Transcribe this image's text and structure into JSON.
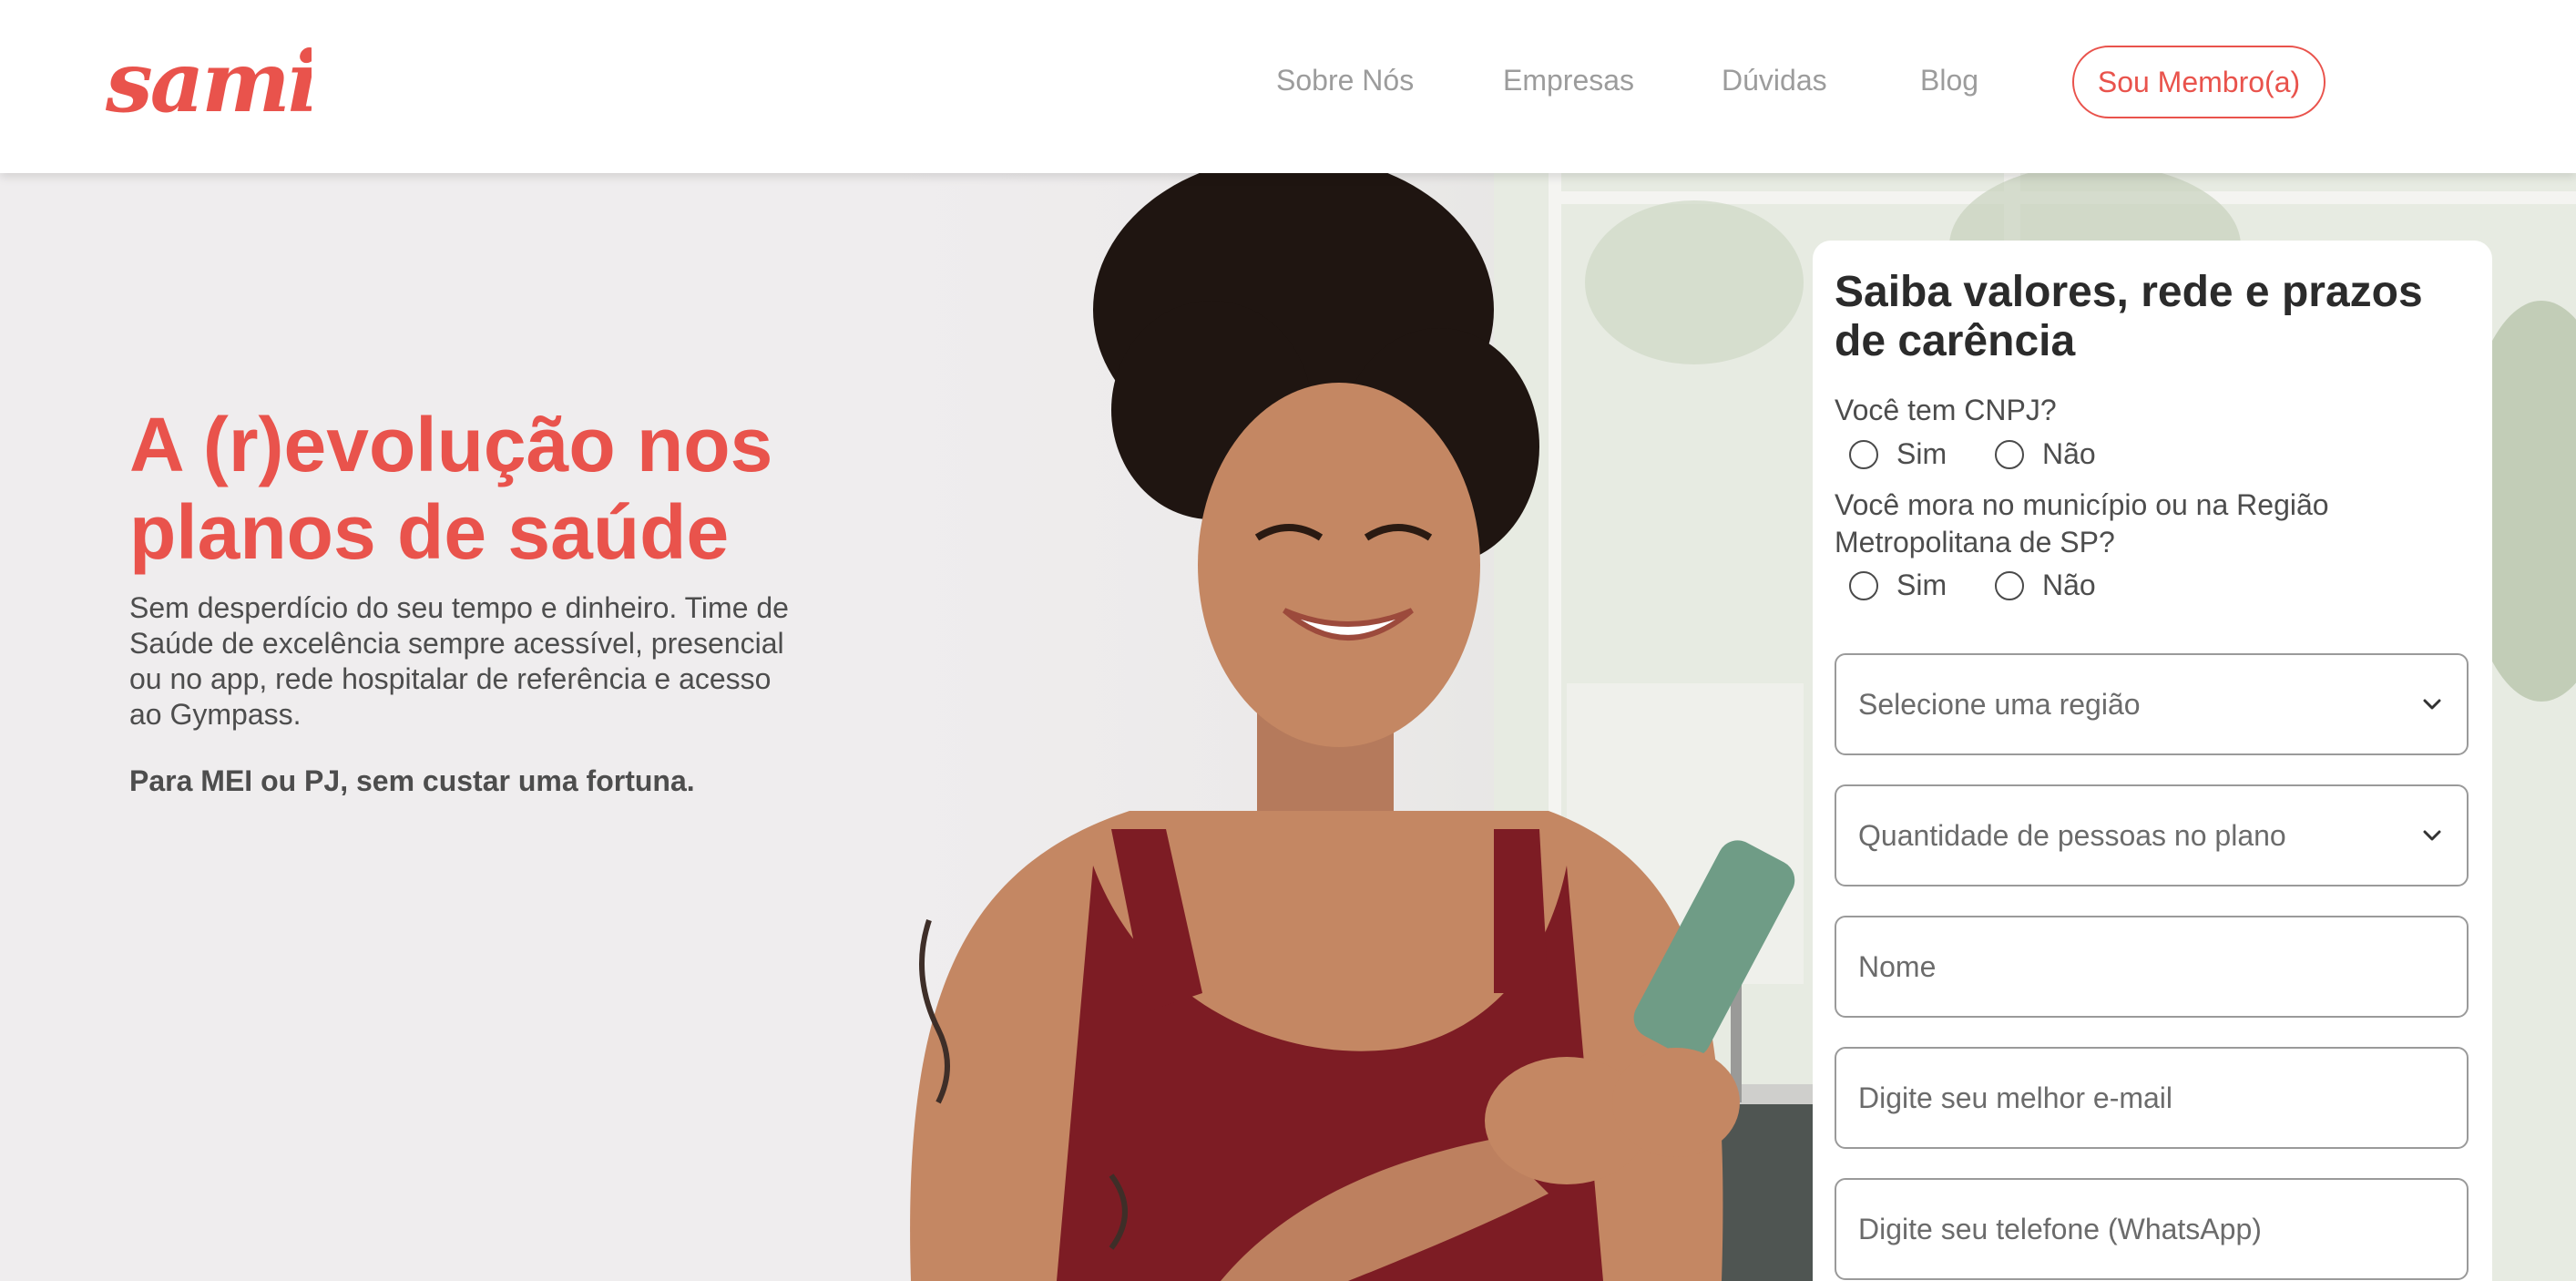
{
  "header": {
    "logo_text": "sami",
    "nav": [
      {
        "label": "Sobre Nós"
      },
      {
        "label": "Empresas"
      },
      {
        "label": "Dúvidas"
      },
      {
        "label": "Blog"
      }
    ],
    "member_button": "Sou Membro(a)"
  },
  "hero": {
    "title": "A (r)evolução nos planos de saúde",
    "description": "Sem desperdício do seu tempo e dinheiro. Time de Saúde de excelência sempre acessível, presencial ou no app, rede hospitalar de referência e acesso ao Gympass.",
    "tagline": "Para MEI ou PJ, sem custar uma fortuna."
  },
  "form": {
    "title": "Saiba valores, rede e prazos de carência",
    "questions": [
      {
        "label": "Você tem CNPJ?",
        "options": [
          "Sim",
          "Não"
        ]
      },
      {
        "label": "Você mora no município ou na Região Metropolitana de SP?",
        "options": [
          "Sim",
          "Não"
        ]
      }
    ],
    "region_select": "Selecione uma região",
    "people_select": "Quantidade de pessoas no plano",
    "name_placeholder": "Nome",
    "email_placeholder": "Digite seu melhor e-mail",
    "phone_placeholder": "Digite seu telefone (WhatsApp)"
  },
  "colors": {
    "brand": "#e9534c",
    "text": "#4d4d4d",
    "nav_text": "#9c9c9c"
  },
  "icons": [
    "chevron-down-icon",
    "chevron-down-icon"
  ]
}
